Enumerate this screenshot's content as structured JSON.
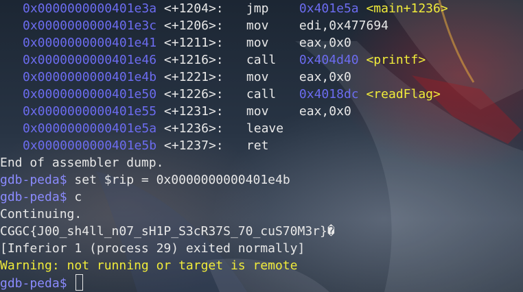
{
  "asm_rows": [
    {
      "addr": "0x0000000000401e3a",
      "offset": "<+1204>:",
      "instr": "jmp",
      "operand": "",
      "target": "0x401e5a",
      "sym": "<main+1236>"
    },
    {
      "addr": "0x0000000000401e3c",
      "offset": "<+1206>:",
      "instr": "mov",
      "operand": "edi,0x477694",
      "target": "",
      "sym": ""
    },
    {
      "addr": "0x0000000000401e41",
      "offset": "<+1211>:",
      "instr": "mov",
      "operand": "eax,0x0",
      "target": "",
      "sym": ""
    },
    {
      "addr": "0x0000000000401e46",
      "offset": "<+1216>:",
      "instr": "call",
      "operand": "",
      "target": "0x404d40",
      "sym": "<printf>"
    },
    {
      "addr": "0x0000000000401e4b",
      "offset": "<+1221>:",
      "instr": "mov",
      "operand": "eax,0x0",
      "target": "",
      "sym": ""
    },
    {
      "addr": "0x0000000000401e50",
      "offset": "<+1226>:",
      "instr": "call",
      "operand": "",
      "target": "0x4018dc",
      "sym": "<readFlag>"
    },
    {
      "addr": "0x0000000000401e55",
      "offset": "<+1231>:",
      "instr": "mov",
      "operand": "eax,0x0",
      "target": "",
      "sym": ""
    },
    {
      "addr": "0x0000000000401e5a",
      "offset": "<+1236>:",
      "instr": "leave",
      "operand": "",
      "target": "",
      "sym": ""
    },
    {
      "addr": "0x0000000000401e5b",
      "offset": "<+1237>:",
      "instr": "ret",
      "operand": "",
      "target": "",
      "sym": ""
    }
  ],
  "end_dump": "End of assembler dump.",
  "prompt": "gdb-peda$",
  "cmd_set_rip": "set $rip = 0x0000000000401e4b",
  "cmd_continue": "c",
  "continuing": "Continuing.",
  "flag_output": "CGGC{J00_sh4ll_n07_sH1P_S3cR37S_70_cuS70M3r}�",
  "inferior_exit": "[Inferior 1 (process 29) exited normally]",
  "warning": "Warning: not running or target is remote"
}
